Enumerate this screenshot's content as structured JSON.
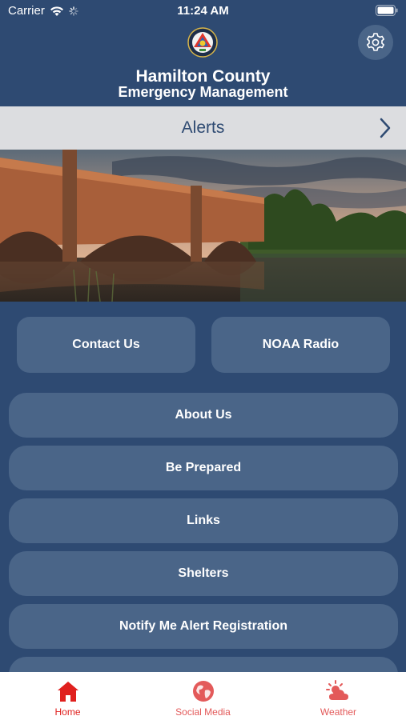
{
  "status_bar": {
    "carrier": "Carrier",
    "time": "11:24 AM"
  },
  "header": {
    "title_line1": "Hamilton County",
    "title_line2": "Emergency Management",
    "logo_icon": "county-seal-logo",
    "settings_icon": "gear-icon"
  },
  "alerts_bar": {
    "label": "Alerts",
    "icon": "chevron-right-icon"
  },
  "banner": {
    "description_icon": "bridge-photo"
  },
  "quick_buttons": [
    {
      "label": "Contact Us"
    },
    {
      "label": "NOAA Radio"
    }
  ],
  "menu_items": [
    {
      "label": "About Us"
    },
    {
      "label": "Be Prepared"
    },
    {
      "label": "Links"
    },
    {
      "label": "Shelters"
    },
    {
      "label": "Notify Me Alert Registration"
    },
    {
      "label": ""
    }
  ],
  "tab_bar": {
    "tabs": [
      {
        "label": "Home",
        "icon": "home-icon",
        "active": true
      },
      {
        "label": "Social Media",
        "icon": "globe-icon",
        "active": false
      },
      {
        "label": "Weather",
        "icon": "cloud-sun-icon",
        "active": false
      }
    ]
  },
  "colors": {
    "background": "#2e4a72",
    "button": "#4a6588",
    "alerts_bar": "#dcdde0",
    "tab_active": "#e0201e",
    "tab_inactive": "#e35a5a"
  }
}
